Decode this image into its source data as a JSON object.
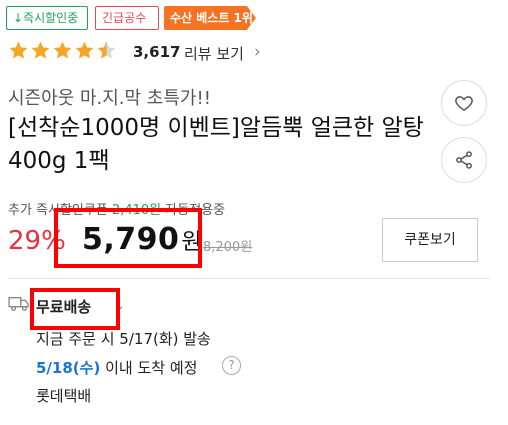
{
  "badges": {
    "instant_discount": "↓즉시할인중",
    "urgent": "긴급공수",
    "best": "수산 베스트 1위"
  },
  "colors": {
    "green": "#1ea35b",
    "red": "#e8303f",
    "orange": "#f57322",
    "blue": "#1a73d9",
    "highlight": "#ff0000"
  },
  "rating": {
    "stars": 4.5,
    "count": "3,617",
    "review_link": "리뷰 보기",
    "chevron": "›"
  },
  "product": {
    "subtitle": "시즌아웃 마.지.막 초특가!!",
    "title": "[선착순1000명 이벤트]알듬뿍 얼큰한 알탕 400g 1팩"
  },
  "actions": {
    "like_icon": "heart-icon",
    "share_icon": "share-icon"
  },
  "coupon": {
    "prefix": "추가 즉시할인쿠폰 ",
    "amount": "2,410원",
    "suffix": " 자동적용중",
    "button": "쿠폰보기"
  },
  "price": {
    "discount": "29%",
    "final": "5,790",
    "unit": "원",
    "original": "8,200원"
  },
  "shipping": {
    "label": "무료배송",
    "chevron": "⌄",
    "dispatch": "지금 주문 시 5/17(화) 발송",
    "arrival_date": "5/18(수)",
    "arrival_suffix": " 이내 도착 예정",
    "help": "?",
    "carrier": "롯데택배"
  }
}
